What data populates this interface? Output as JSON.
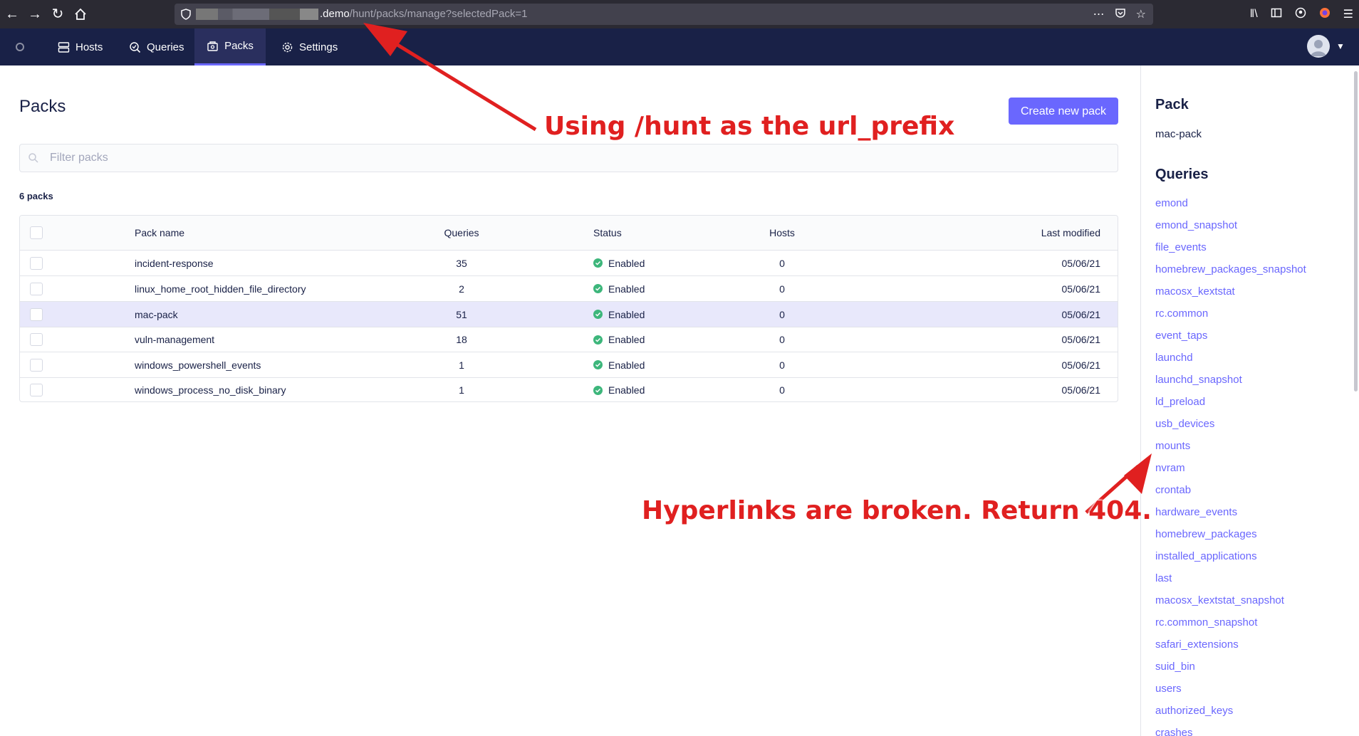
{
  "browser": {
    "url_host": ".demo",
    "url_path": "/hunt/packs/manage?selectedPack=1",
    "icons": [
      "back-icon",
      "forward-icon",
      "reload-icon",
      "home-icon",
      "shield-icon",
      "more-icon",
      "pocket-icon",
      "star-icon",
      "library-icon",
      "sidebar-icon",
      "account-icon",
      "firefox-icon",
      "menu-icon"
    ]
  },
  "nav": {
    "items": [
      {
        "label": "Hosts",
        "icon": "hosts-icon"
      },
      {
        "label": "Queries",
        "icon": "queries-icon"
      },
      {
        "label": "Packs",
        "icon": "packs-icon",
        "active": true
      },
      {
        "label": "Settings",
        "icon": "gear-icon"
      }
    ],
    "accent": "#6a67fe",
    "background": "#192147"
  },
  "page": {
    "title": "Packs",
    "create_button": "Create new pack",
    "filter_placeholder": "Filter packs",
    "pack_count": "6 packs"
  },
  "table": {
    "headers": {
      "name": "Pack name",
      "queries": "Queries",
      "status": "Status",
      "hosts": "Hosts",
      "modified": "Last modified"
    },
    "rows": [
      {
        "name": "incident-response",
        "queries": "35",
        "status": "Enabled",
        "hosts": "0",
        "modified": "05/06/21",
        "selected": false
      },
      {
        "name": "linux_home_root_hidden_file_directory",
        "queries": "2",
        "status": "Enabled",
        "hosts": "0",
        "modified": "05/06/21",
        "selected": false
      },
      {
        "name": "mac-pack",
        "queries": "51",
        "status": "Enabled",
        "hosts": "0",
        "modified": "05/06/21",
        "selected": true
      },
      {
        "name": "vuln-management",
        "queries": "18",
        "status": "Enabled",
        "hosts": "0",
        "modified": "05/06/21",
        "selected": false
      },
      {
        "name": "windows_powershell_events",
        "queries": "1",
        "status": "Enabled",
        "hosts": "0",
        "modified": "05/06/21",
        "selected": false
      },
      {
        "name": "windows_process_no_disk_binary",
        "queries": "1",
        "status": "Enabled",
        "hosts": "0",
        "modified": "05/06/21",
        "selected": false
      }
    ],
    "status_color": "#3db67b"
  },
  "sidebar": {
    "pack_heading": "Pack",
    "pack_name": "mac-pack",
    "queries_heading": "Queries",
    "queries": [
      "emond",
      "emond_snapshot",
      "file_events",
      "homebrew_packages_snapshot",
      "macosx_kextstat",
      "rc.common",
      "event_taps",
      "launchd",
      "launchd_snapshot",
      "ld_preload",
      "usb_devices",
      "mounts",
      "nvram",
      "crontab",
      "hardware_events",
      "homebrew_packages",
      "installed_applications",
      "last",
      "macosx_kextstat_snapshot",
      "rc.common_snapshot",
      "safari_extensions",
      "suid_bin",
      "users",
      "authorized_keys",
      "crashes"
    ]
  },
  "annotations": {
    "top": "Using /hunt as the url_prefix",
    "bottom": "Hyperlinks are broken. Return 404.",
    "color": "#e02020"
  }
}
